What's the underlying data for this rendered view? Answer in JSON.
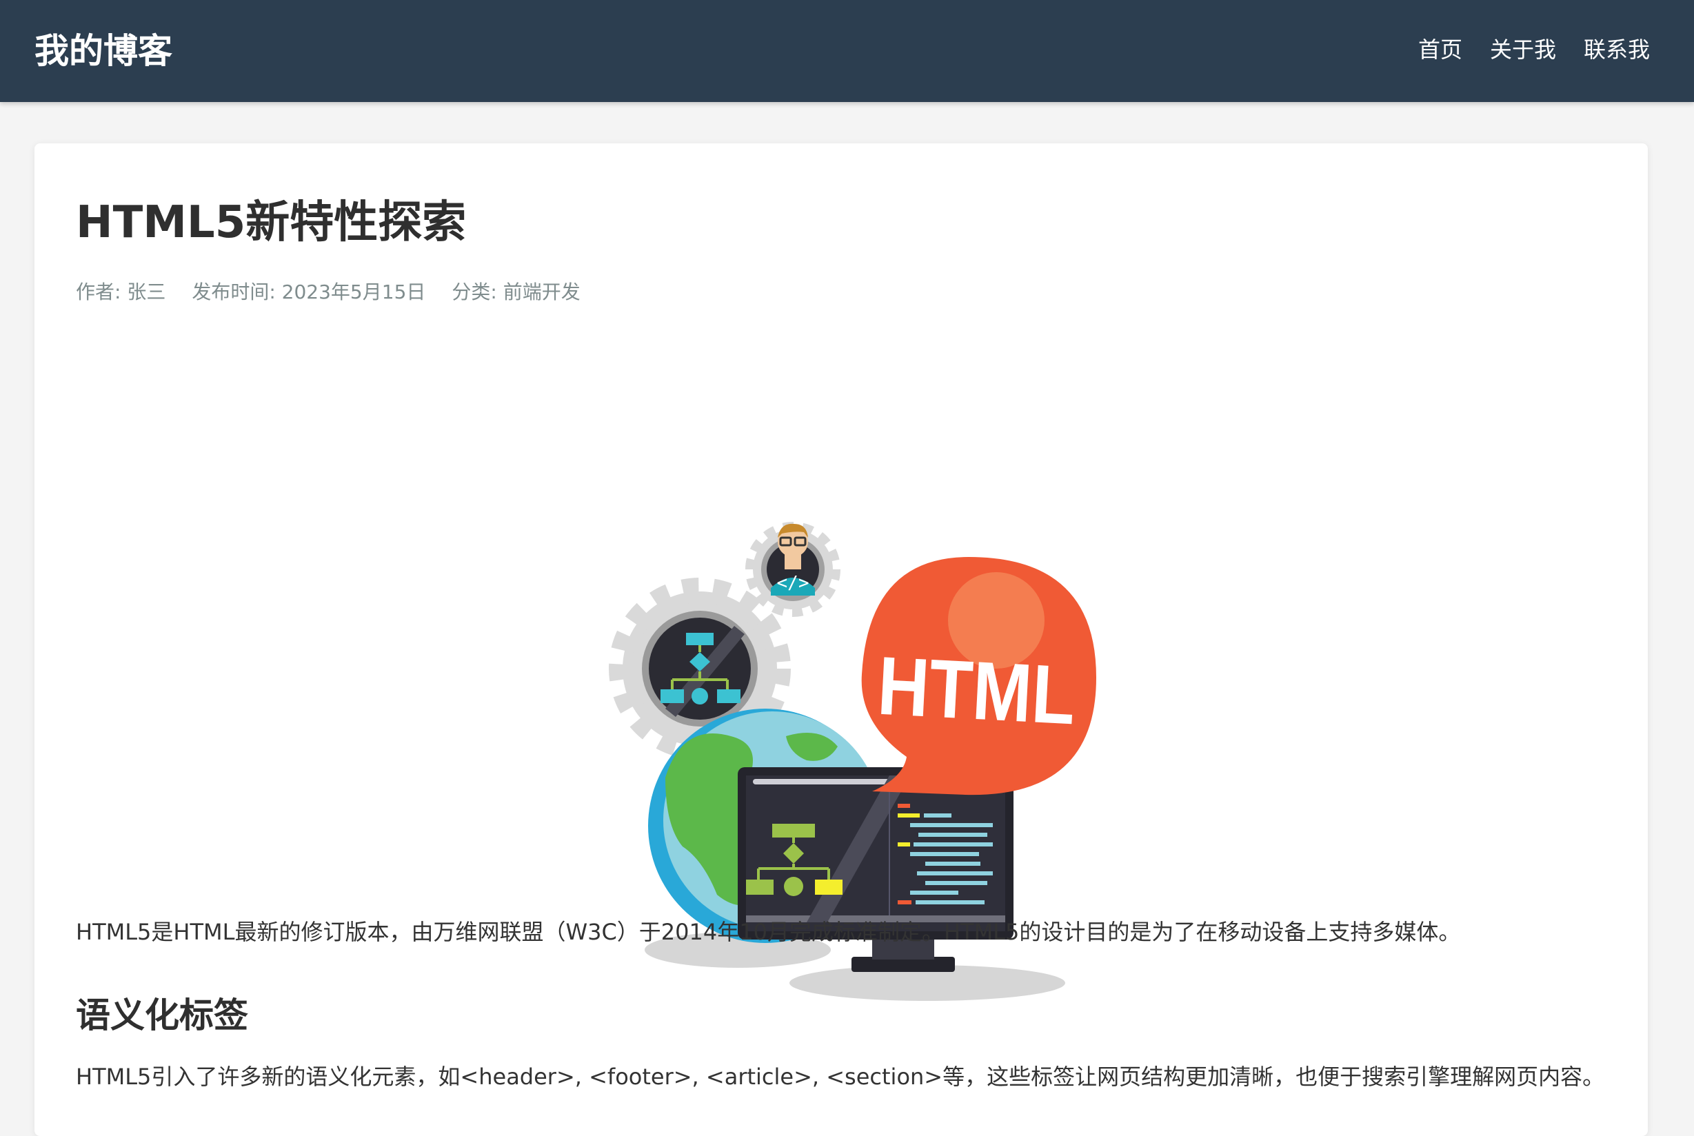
{
  "site": {
    "title": "我的博客",
    "nav": [
      "首页",
      "关于我",
      "联系我"
    ]
  },
  "post": {
    "title": "HTML5新特性探索",
    "meta": {
      "author": "作者: 张三",
      "published": "发布时间: 2023年5月15日",
      "category": "分类: 前端开发"
    },
    "image": {
      "bubble_text": "HTML",
      "avatar_code": "</>"
    },
    "paragraph_1": "HTML5是HTML最新的修订版本，由万维网联盟（W3C）于2014年10月完成标准制定。HTML5的设计目的是为了在移动设备上支持多媒体。",
    "section_heading": "语义化标签",
    "paragraph_2": "HTML5引入了许多新的语义化元素，如<header>, <footer>, <article>, <section>等，这些标签让网页结构更加清晰，也便于搜索引擎理解网页内容。"
  },
  "colors": {
    "header_bg": "#2c3e50",
    "page_bg": "#f4f4f4",
    "meta_text": "#7f8c8d",
    "bubble": "#f05a35"
  }
}
